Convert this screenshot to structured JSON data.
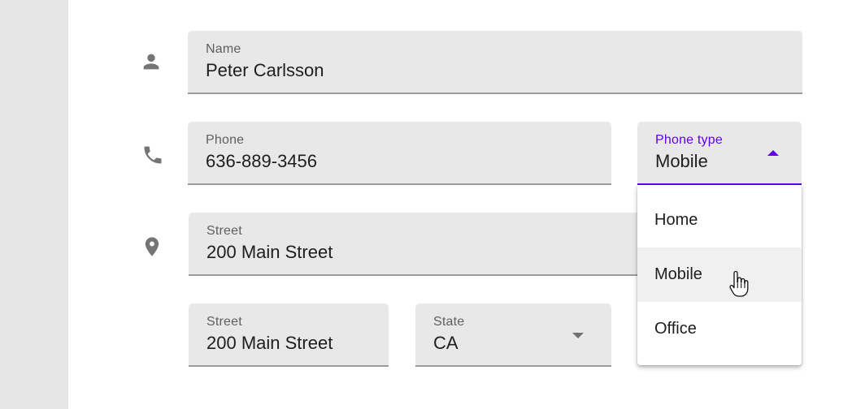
{
  "name_field": {
    "label": "Name",
    "value": "Peter Carlsson"
  },
  "phone_field": {
    "label": "Phone",
    "value": "636-889-3456"
  },
  "phone_type_field": {
    "label": "Phone type",
    "value": "Mobile",
    "expanded": true
  },
  "phone_type_options": [
    "Home",
    "Mobile",
    "Office"
  ],
  "hovered_option": "Mobile",
  "street_field_1": {
    "label": "Street",
    "value": "200 Main Street"
  },
  "street_field_2": {
    "label": "Street",
    "value": "200 Main Street"
  },
  "state_field": {
    "label": "State",
    "value": "CA"
  },
  "icons": [
    "person-icon",
    "phone-icon",
    "location-pin-icon",
    "chevron-down-icon",
    "chevron-up-icon",
    "hand-pointer-cursor"
  ],
  "colors": {
    "accent": "#6200ee",
    "field_bg": "#e8e8e8",
    "side_panel": "#e6e6e6",
    "icon": "#757575"
  }
}
